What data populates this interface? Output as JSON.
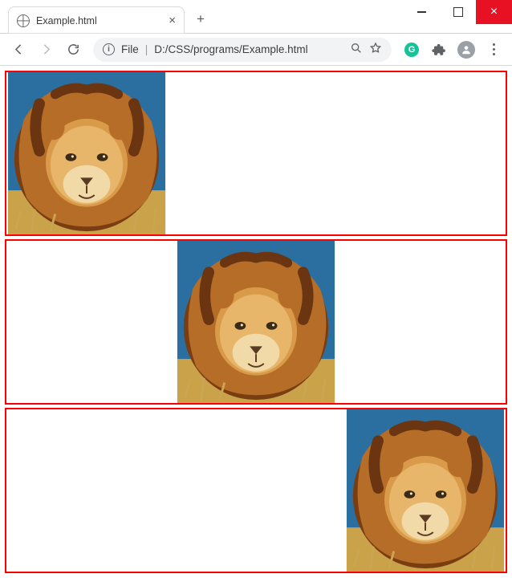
{
  "window": {
    "tab_title": "Example.html",
    "newtab_label": "+",
    "close_glyph": "×"
  },
  "toolbar": {
    "url_scheme_label": "File",
    "url_path": "D:/CSS/programs/Example.html"
  },
  "content": {
    "boxes": [
      {
        "position": "left"
      },
      {
        "position": "center"
      },
      {
        "position": "right"
      }
    ]
  }
}
